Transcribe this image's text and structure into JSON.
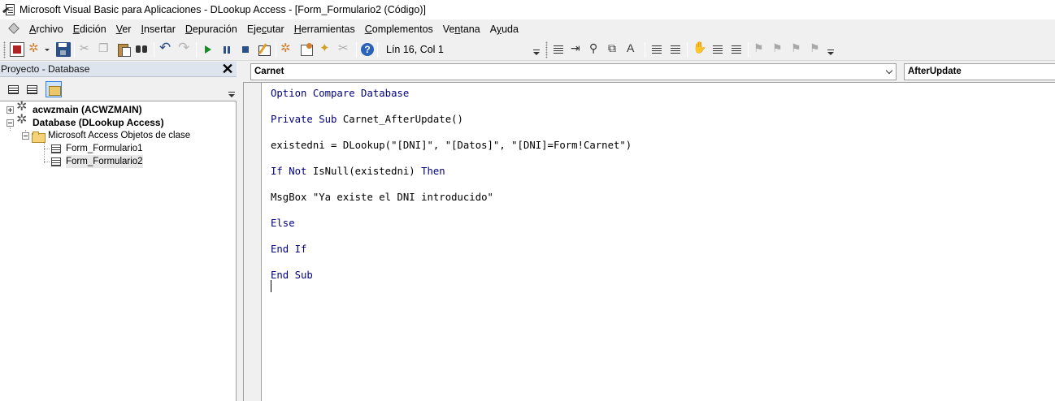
{
  "window": {
    "title": "Microsoft Visual Basic para Aplicaciones - DLookup Access - [Form_Formulario2 (Código)]"
  },
  "menu": [
    {
      "pre": "",
      "u": "A",
      "post": "rchivo"
    },
    {
      "pre": "",
      "u": "E",
      "post": "dición"
    },
    {
      "pre": "",
      "u": "V",
      "post": "er"
    },
    {
      "pre": "",
      "u": "I",
      "post": "nsertar"
    },
    {
      "pre": "",
      "u": "D",
      "post": "epuración"
    },
    {
      "pre": "Eje",
      "u": "c",
      "post": "utar"
    },
    {
      "pre": "",
      "u": "H",
      "post": "erramientas"
    },
    {
      "pre": "",
      "u": "C",
      "post": "omplementos"
    },
    {
      "pre": "Ve",
      "u": "n",
      "post": "tana"
    },
    {
      "pre": "A",
      "u": "y",
      "post": "uda"
    }
  ],
  "toolbar": {
    "position_status": "Lín 16, Col 1"
  },
  "project": {
    "title": "Proyecto - Database",
    "close_label": "✕",
    "tree": {
      "node1": "acwzmain (ACWZMAIN)",
      "node2": "Database (DLookup Access)",
      "folder": "Microsoft Access Objetos de clase",
      "form1": "Form_Formulario1",
      "form2": "Form_Formulario2"
    }
  },
  "code_window": {
    "object_combo": "Carnet",
    "procedure_combo": "AfterUpdate",
    "lines": {
      "l1_kw": "Option Compare Database",
      "l2_kw": "Private Sub",
      "l2_rest": " Carnet_AfterUpdate()",
      "l3": "existedni = DLookup(\"[DNI]\", \"[Datos]\", \"[DNI]=Form!Carnet\")",
      "l4_kw1": "If Not",
      "l4_mid": " IsNull(existedni) ",
      "l4_kw2": "Then",
      "l5": "MsgBox \"Ya existe el DNI introducido\"",
      "l6_kw": "Else",
      "l7_kw": "End If",
      "l8_kw": "End Sub"
    }
  },
  "colors": {
    "keyword": "#00007f",
    "panel_header": "#dde4ee"
  }
}
